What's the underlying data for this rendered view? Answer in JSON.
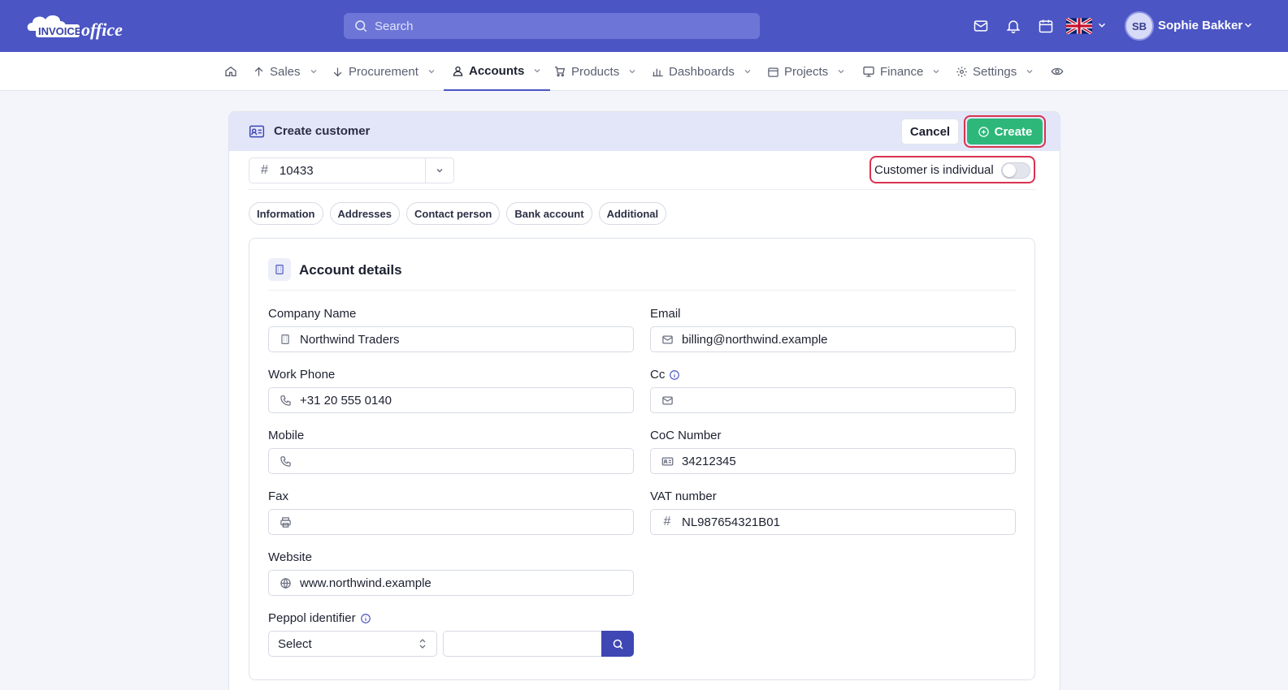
{
  "app": {
    "brand_a": "INVOICE",
    "brand_b": "office",
    "search_placeholder": "Search",
    "user_initials": "SB",
    "user_name": "Sophie Bakker"
  },
  "nav": {
    "items": [
      {
        "label": "Sales"
      },
      {
        "label": "Procurement"
      },
      {
        "label": "Accounts"
      },
      {
        "label": "Products"
      },
      {
        "label": "Dashboards"
      },
      {
        "label": "Projects"
      },
      {
        "label": "Finance"
      },
      {
        "label": "Settings"
      }
    ],
    "active": "Accounts"
  },
  "form": {
    "title": "Create customer",
    "cancel_label": "Cancel",
    "create_label": "Create",
    "customer_number": "10433",
    "individual_label": "Customer is individual",
    "individual_on": false,
    "tabs": [
      "Information",
      "Addresses",
      "Contact person",
      "Bank account",
      "Additional"
    ],
    "section_title": "Account details",
    "fields": {
      "company_name": {
        "label": "Company Name",
        "value": "Northwind Traders"
      },
      "email": {
        "label": "Email",
        "value": "billing@northwind.example"
      },
      "work_phone": {
        "label": "Work Phone",
        "value": "+31 20 555 0140"
      },
      "cc": {
        "label": "Cc",
        "value": ""
      },
      "mobile": {
        "label": "Mobile",
        "value": ""
      },
      "coc": {
        "label": "CoC Number",
        "value": "34212345"
      },
      "fax": {
        "label": "Fax",
        "value": ""
      },
      "vat": {
        "label": "VAT number",
        "value": "NL987654321B01"
      },
      "website": {
        "label": "Website",
        "value": "www.northwind.example"
      },
      "peppol": {
        "label": "Peppol identifier",
        "select_value": "Select",
        "value": ""
      }
    }
  },
  "colors": {
    "topbar": "#4b55c4",
    "create_button": "#2db87a",
    "highlight_border": "#d8334f"
  }
}
